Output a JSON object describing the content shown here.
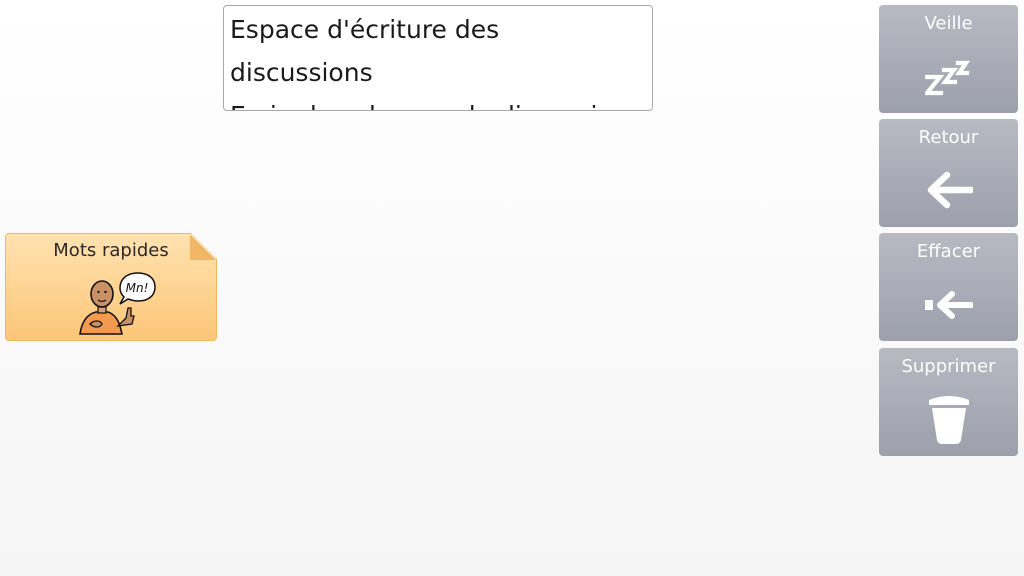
{
  "message_box": {
    "text": "Espace d'écriture des\ndiscussions\nEcrire les phrases de discussion"
  },
  "folder": {
    "label": "Mots rapides",
    "bubble_text": "Mn!",
    "icon": "person-speaking-icon",
    "colors": {
      "fill": "#fcc678",
      "border": "#f0b760"
    }
  },
  "side_buttons": [
    {
      "label": "Veille",
      "icon": "sleep-zzz-icon"
    },
    {
      "label": "Retour",
      "icon": "arrow-left-icon"
    },
    {
      "label": "Effacer",
      "icon": "backspace-icon"
    },
    {
      "label": "Supprimer",
      "icon": "trash-icon"
    }
  ],
  "colors": {
    "side_button": "#a8abb5",
    "side_button_text": "#ffffff"
  }
}
